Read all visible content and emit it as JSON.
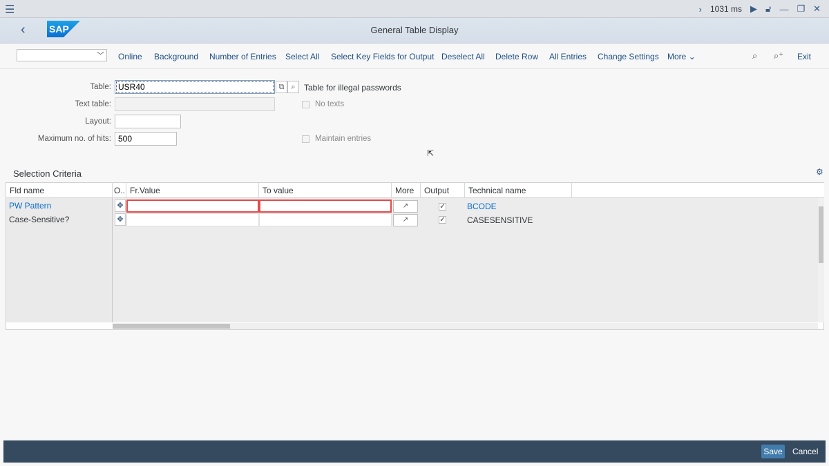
{
  "topbar": {
    "time": "1031 ms"
  },
  "header": {
    "logo_text": "SAP",
    "title": "General Table Display"
  },
  "toolbar": {
    "dropdown_value": "",
    "buttons": {
      "online": "Online",
      "background": "Background",
      "number_of_entries": "Number of Entries",
      "select_all": "Select All",
      "select_key_fields": "Select Key Fields for Output",
      "deselect_all": "Deselect All",
      "delete_row": "Delete Row",
      "all_entries": "All Entries",
      "change_settings": "Change Settings",
      "more": "More",
      "exit": "Exit"
    }
  },
  "form": {
    "table_label": "Table:",
    "table_value": "USR40",
    "table_description": "Table for illegal passwords",
    "text_table_label": "Text table:",
    "text_table_value": "",
    "no_texts_label": "No texts",
    "layout_label": "Layout:",
    "layout_value": "",
    "max_hits_label": "Maximum no. of hits:",
    "max_hits_value": "500",
    "maintain_entries_label": "Maintain entries"
  },
  "selection": {
    "title": "Selection Criteria",
    "columns": {
      "fld_name": "Fld name",
      "op": "O..",
      "fr_value": "Fr.Value",
      "to_value": "To value",
      "more": "More",
      "output": "Output",
      "technical_name": "Technical name"
    },
    "rows": [
      {
        "fld_name": "PW Pattern",
        "fr_value": "",
        "to_value": "",
        "output": "✓",
        "technical_name": "BCODE"
      },
      {
        "fld_name": "Case-Sensitive?",
        "fr_value": "",
        "to_value": "",
        "output": "✓",
        "technical_name": "CASESENSITIVE"
      }
    ],
    "horizontal_scroll_fraction": 0.17,
    "vertical_scroll_fraction": 0.45
  },
  "footer": {
    "save": "Save",
    "cancel": "Cancel"
  },
  "colors": {
    "accent": "#0a6ed1",
    "footer": "#354a5f",
    "save_button": "#427cac",
    "error_border": "#e34b4b"
  }
}
